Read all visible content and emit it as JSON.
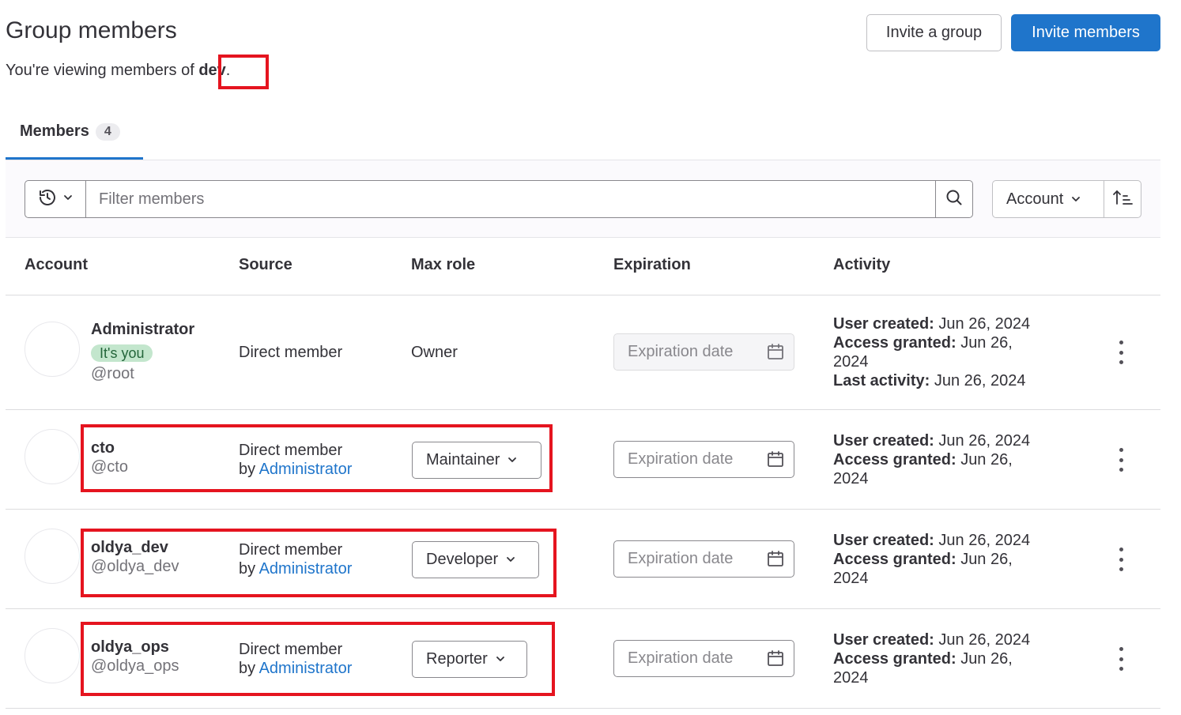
{
  "header": {
    "title": "Group members",
    "subtitle_prefix": "You're viewing members of ",
    "group_name": "dev",
    "subtitle_suffix": ".",
    "invite_group_label": "Invite a group",
    "invite_members_label": "Invite members"
  },
  "tabs": [
    {
      "label": "Members",
      "count": "4",
      "active": true
    }
  ],
  "filter": {
    "history_icon": "history-icon",
    "placeholder": "Filter members",
    "search_icon": "search-icon",
    "sort_label": "Account",
    "sort_direction_icon": "sort-ascending-icon"
  },
  "table": {
    "columns": [
      "Account",
      "Source",
      "Max role",
      "Expiration",
      "Activity"
    ],
    "rows": [
      {
        "name": "Administrator",
        "badge": "It's you",
        "handle": "@root",
        "source_line1": "Direct member",
        "source_by": "",
        "source_link": "",
        "role": "Owner",
        "role_editable": false,
        "expiration_placeholder": "Expiration date",
        "user_created_label": "User created:",
        "user_created": "Jun 26, 2024",
        "access_granted_label": "Access granted:",
        "access_granted_1": "Jun 26,",
        "access_granted_2": "2024",
        "last_activity_label": "Last activity:",
        "last_activity": "Jun 26, 2024"
      },
      {
        "name": "cto",
        "handle": "@cto",
        "source_line1": "Direct member",
        "source_by": "by ",
        "source_link": "Administrator",
        "role": "Maintainer",
        "role_editable": true,
        "expiration_placeholder": "Expiration date",
        "user_created_label": "User created:",
        "user_created": "Jun 26, 2024",
        "access_granted_label": "Access granted:",
        "access_granted_1": "Jun 26,",
        "access_granted_2": "2024"
      },
      {
        "name": "oldya_dev",
        "handle": "@oldya_dev",
        "source_line1": "Direct member",
        "source_by": "by ",
        "source_link": "Administrator",
        "role": "Developer",
        "role_editable": true,
        "expiration_placeholder": "Expiration date",
        "user_created_label": "User created:",
        "user_created": "Jun 26, 2024",
        "access_granted_label": "Access granted:",
        "access_granted_1": "Jun 26,",
        "access_granted_2": "2024"
      },
      {
        "name": "oldya_ops",
        "handle": "@oldya_ops",
        "source_line1": "Direct member",
        "source_by": "by ",
        "source_link": "Administrator",
        "role": "Reporter",
        "role_editable": true,
        "expiration_placeholder": "Expiration date",
        "user_created_label": "User created:",
        "user_created": "Jun 26, 2024",
        "access_granted_label": "Access granted:",
        "access_granted_1": "Jun 26,",
        "access_granted_2": "2024"
      }
    ]
  },
  "colors": {
    "primary": "#1f75cb",
    "highlight_box": "#e5141f",
    "badge_bg": "#c3e6cd",
    "badge_text": "#24663b"
  }
}
